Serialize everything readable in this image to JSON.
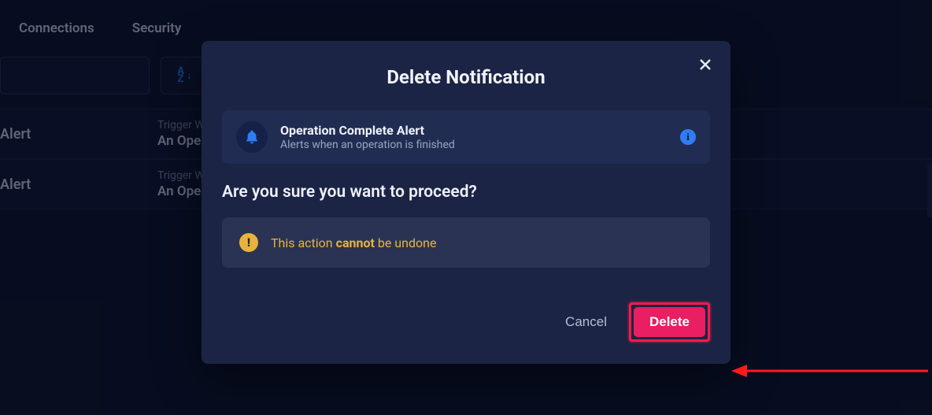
{
  "nav": {
    "tabs": [
      "Connections",
      "Security"
    ]
  },
  "toolbar": {
    "sort_label": "A\nZ"
  },
  "rows": [
    {
      "name": "Alert",
      "trigger_label": "Trigger When",
      "trigger_value": "An Operation"
    },
    {
      "name": "Alert",
      "trigger_label": "Trigger When",
      "trigger_value": "An Operation"
    }
  ],
  "modal": {
    "title": "Delete Notification",
    "notification": {
      "name": "Operation Complete Alert",
      "description": "Alerts when an operation is finished",
      "info_glyph": "i"
    },
    "question": "Are you sure you want to proceed?",
    "warning_prefix": "This action ",
    "warning_strong": "cannot",
    "warning_suffix": " be undone",
    "warn_glyph": "!",
    "cancel_label": "Cancel",
    "delete_label": "Delete"
  }
}
